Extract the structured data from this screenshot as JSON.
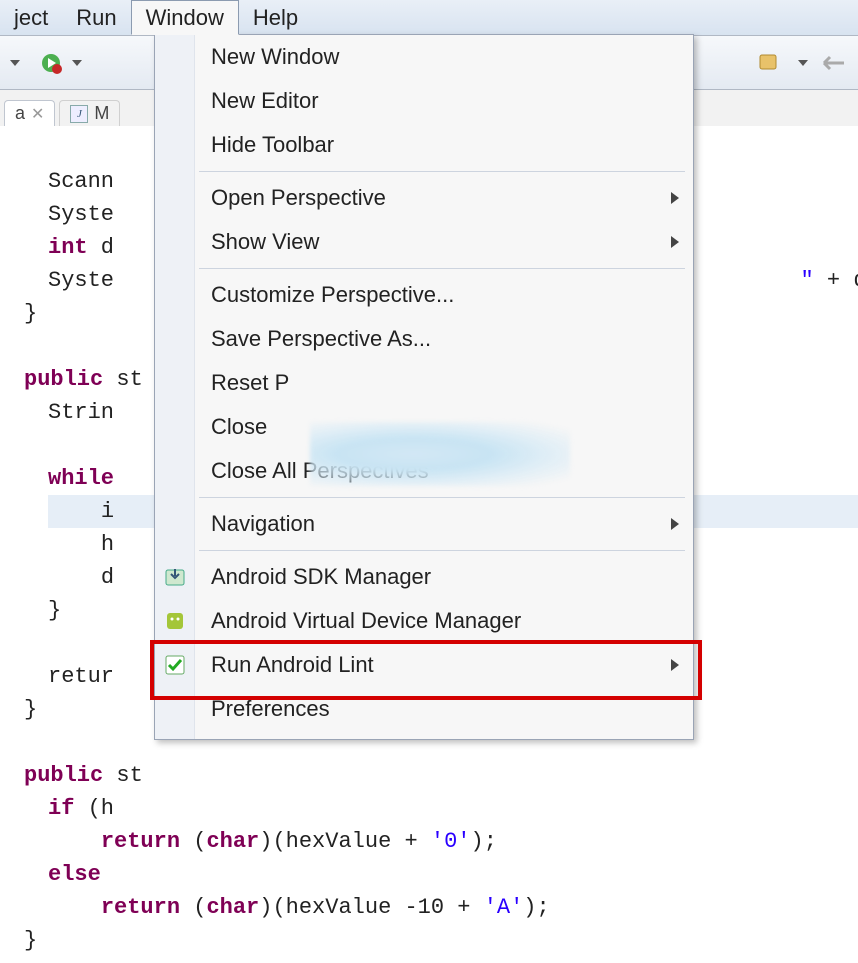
{
  "menubar": {
    "items": [
      "ject",
      "Run",
      "Window",
      "Help"
    ],
    "active_index": 2
  },
  "toolbar": {
    "icons": [
      "dropdown",
      "run-green",
      "dropdown"
    ]
  },
  "tabs": {
    "items": [
      {
        "label": "a",
        "closable": true
      },
      {
        "label": "M",
        "icon": "java-file"
      }
    ]
  },
  "code": {
    "l1": "Scann",
    "l2": "Syste",
    "l3a": "int",
    "l3b": " d",
    "l4": "Syste",
    "l4tail": "\"",
    "l4plus": " + decim",
    "l5": "}",
    "l7a": "public",
    "l7b": " st",
    "l8": "Strin",
    "l10a": "while",
    "l11": "i",
    "l12": "h",
    "l13": "d",
    "l14": "}",
    "l16": "retur",
    "l17": "}",
    "l19a": "public",
    "l19b": " st",
    "l20a": "if",
    "l20b": " (h",
    "l21a": "return",
    "l21b": " (",
    "l21c": "char",
    "l21d": ")(hexValue + ",
    "l21e": "'0'",
    "l21f": ");",
    "l22": "else",
    "l23a": "return",
    "l23b": " (",
    "l23c": "char",
    "l23d": ")(hexValue -10 + ",
    "l23e": "'A'",
    "l23f": ");",
    "l24": "}"
  },
  "menu": {
    "items": [
      {
        "label": "New Window"
      },
      {
        "label": "New Editor"
      },
      {
        "label": "Hide Toolbar"
      },
      {
        "sep": true
      },
      {
        "label": "Open Perspective",
        "submenu": true
      },
      {
        "label": "Show View",
        "submenu": true
      },
      {
        "sep": true
      },
      {
        "label": "Customize Perspective..."
      },
      {
        "label": "Save Perspective As..."
      },
      {
        "label": "Reset P"
      },
      {
        "label": "Close"
      },
      {
        "label": "Close All Perspectives"
      },
      {
        "sep": true
      },
      {
        "label": "Navigation",
        "submenu": true
      },
      {
        "sep": true
      },
      {
        "label": "Android SDK Manager",
        "icon": "android-sdk",
        "highlight": true
      },
      {
        "label": "Android Virtual Device Manager",
        "icon": "android-avd"
      },
      {
        "label": "Run Android Lint",
        "icon": "checkbox-green",
        "submenu": true
      },
      {
        "label": "Preferences"
      }
    ]
  }
}
